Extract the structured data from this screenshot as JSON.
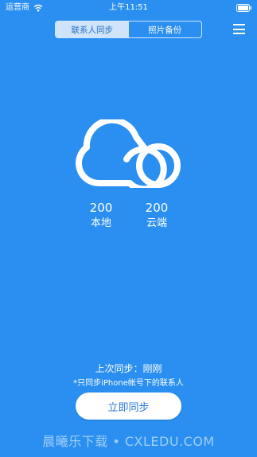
{
  "status_bar": {
    "carrier": "运营商",
    "time": "上午11:51"
  },
  "tabs": [
    {
      "label": "联系人同步",
      "active": true
    },
    {
      "label": "照片备份",
      "active": false
    }
  ],
  "counts": {
    "local": {
      "value": "200",
      "label": "本地"
    },
    "cloud": {
      "value": "200",
      "label": "云端"
    }
  },
  "last_sync": "上次同步：刚刚",
  "note": "*只同步iPhone帐号下的联系人",
  "sync_button": "立即同步",
  "watermark": "晨曦乐下载 • CXLEDU.COM",
  "colors": {
    "background": "#2a8ff0",
    "tab_active_bg": "#cfe4fb",
    "button_text": "#2a78d8"
  },
  "icons": [
    "wifi-icon",
    "battery-icon",
    "menu-icon",
    "cloud-icon"
  ]
}
